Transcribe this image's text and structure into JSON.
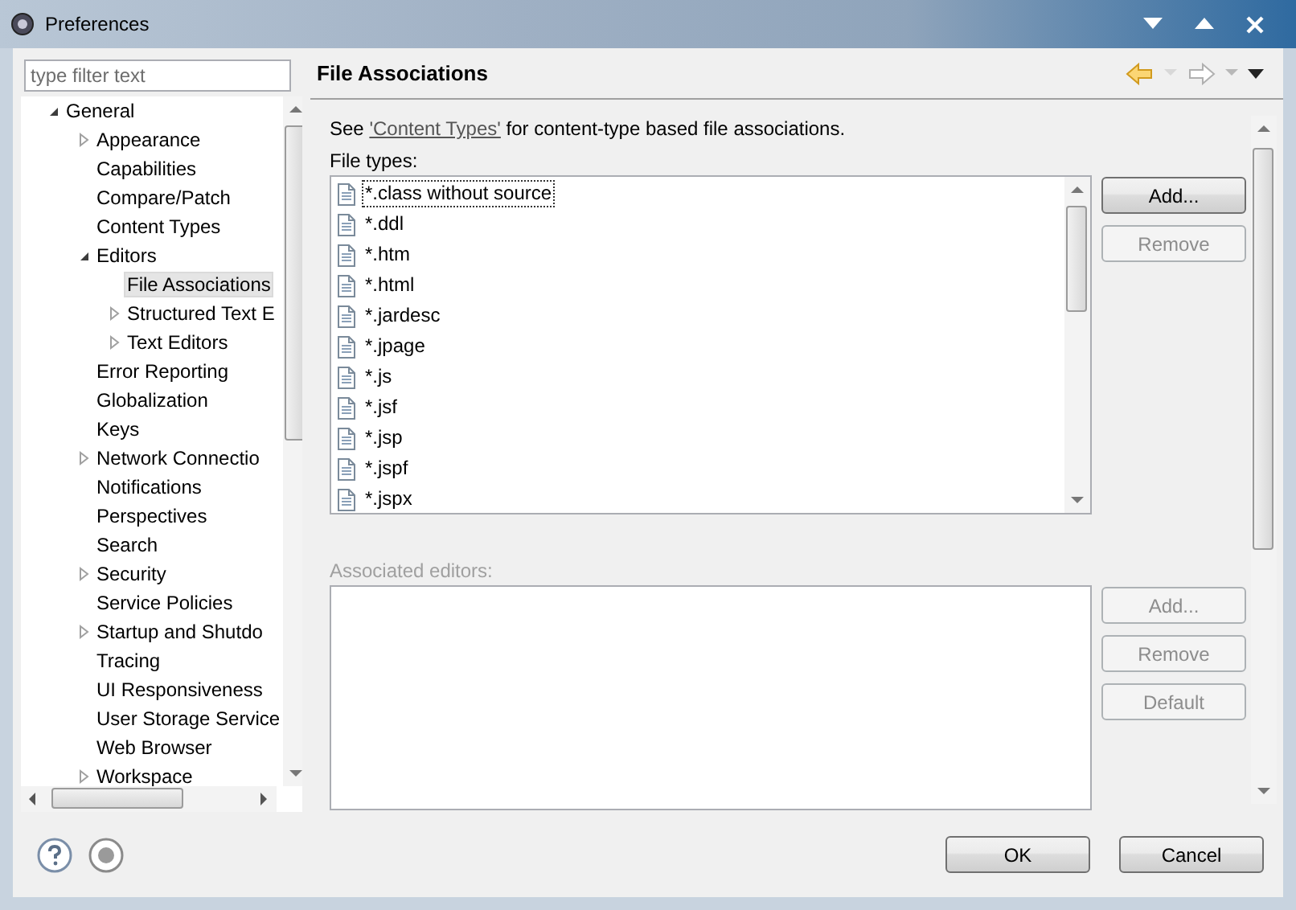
{
  "window": {
    "title": "Preferences"
  },
  "filter": {
    "placeholder": "type filter text"
  },
  "tree": [
    {
      "label": "General",
      "expanded": true,
      "selected": false,
      "children": [
        {
          "label": "Appearance",
          "expanded": false,
          "selected": false
        },
        {
          "label": "Capabilities",
          "selected": false
        },
        {
          "label": "Compare/Patch",
          "selected": false
        },
        {
          "label": "Content Types",
          "selected": false
        },
        {
          "label": "Editors",
          "expanded": true,
          "selected": false,
          "children": [
            {
              "label": "File Associations",
              "selected": true
            },
            {
              "label": "Structured Text E",
              "expanded": false,
              "selected": false
            },
            {
              "label": "Text Editors",
              "expanded": false,
              "selected": false
            }
          ]
        },
        {
          "label": "Error Reporting",
          "selected": false
        },
        {
          "label": "Globalization",
          "selected": false
        },
        {
          "label": "Keys",
          "selected": false
        },
        {
          "label": "Network Connectio",
          "expanded": false,
          "selected": false
        },
        {
          "label": "Notifications",
          "selected": false
        },
        {
          "label": "Perspectives",
          "selected": false
        },
        {
          "label": "Search",
          "selected": false
        },
        {
          "label": "Security",
          "expanded": false,
          "selected": false
        },
        {
          "label": "Service Policies",
          "selected": false
        },
        {
          "label": "Startup and Shutdo",
          "expanded": false,
          "selected": false
        },
        {
          "label": "Tracing",
          "selected": false
        },
        {
          "label": "UI Responsiveness",
          "selected": false
        },
        {
          "label": "User Storage Service",
          "selected": false
        },
        {
          "label": "Web Browser",
          "selected": false
        },
        {
          "label": "Workspace",
          "expanded": false,
          "selected": false
        }
      ]
    }
  ],
  "page": {
    "title": "File Associations"
  },
  "intro": {
    "before": "See ",
    "link": "'Content Types'",
    "after": " for content-type based file associations."
  },
  "file_types": {
    "label": "File types:",
    "items": [
      {
        "name": "*.class without source",
        "focused": true
      },
      {
        "name": "*.ddl",
        "focused": false
      },
      {
        "name": "*.htm",
        "focused": false
      },
      {
        "name": "*.html",
        "focused": false
      },
      {
        "name": "*.jardesc",
        "focused": false
      },
      {
        "name": "*.jpage",
        "focused": false
      },
      {
        "name": "*.js",
        "focused": false
      },
      {
        "name": "*.jsf",
        "focused": false
      },
      {
        "name": "*.jsp",
        "focused": false
      },
      {
        "name": "*.jspf",
        "focused": false
      },
      {
        "name": "*.jspx",
        "focused": false
      }
    ]
  },
  "file_type_buttons": [
    {
      "label": "Add...",
      "disabled": false
    },
    {
      "label": "Remove",
      "disabled": true
    }
  ],
  "associated_editors": {
    "label": "Associated editors:",
    "disabled": true
  },
  "editor_buttons": [
    {
      "label": "Add...",
      "disabled": true
    },
    {
      "label": "Remove",
      "disabled": true
    },
    {
      "label": "Default",
      "disabled": true
    }
  ],
  "dialog_buttons": [
    {
      "label": "OK"
    },
    {
      "label": "Cancel"
    }
  ]
}
